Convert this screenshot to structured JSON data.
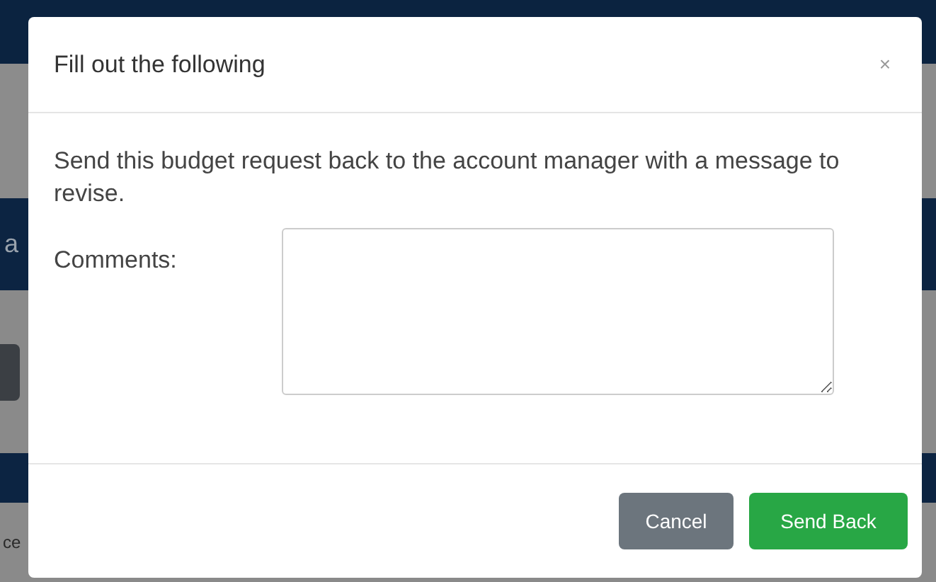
{
  "background": {
    "fragments": [
      "a",
      "ce"
    ]
  },
  "dialog": {
    "title": "Fill out the following",
    "close": "×",
    "message": "Send this budget request back to the account manager with a message to revise.",
    "comments": {
      "label": "Comments:"
    },
    "buttons": [
      {
        "label": "Cancel",
        "kind": "secondary"
      },
      {
        "label": "Send Back",
        "kind": "primary"
      }
    ]
  }
}
